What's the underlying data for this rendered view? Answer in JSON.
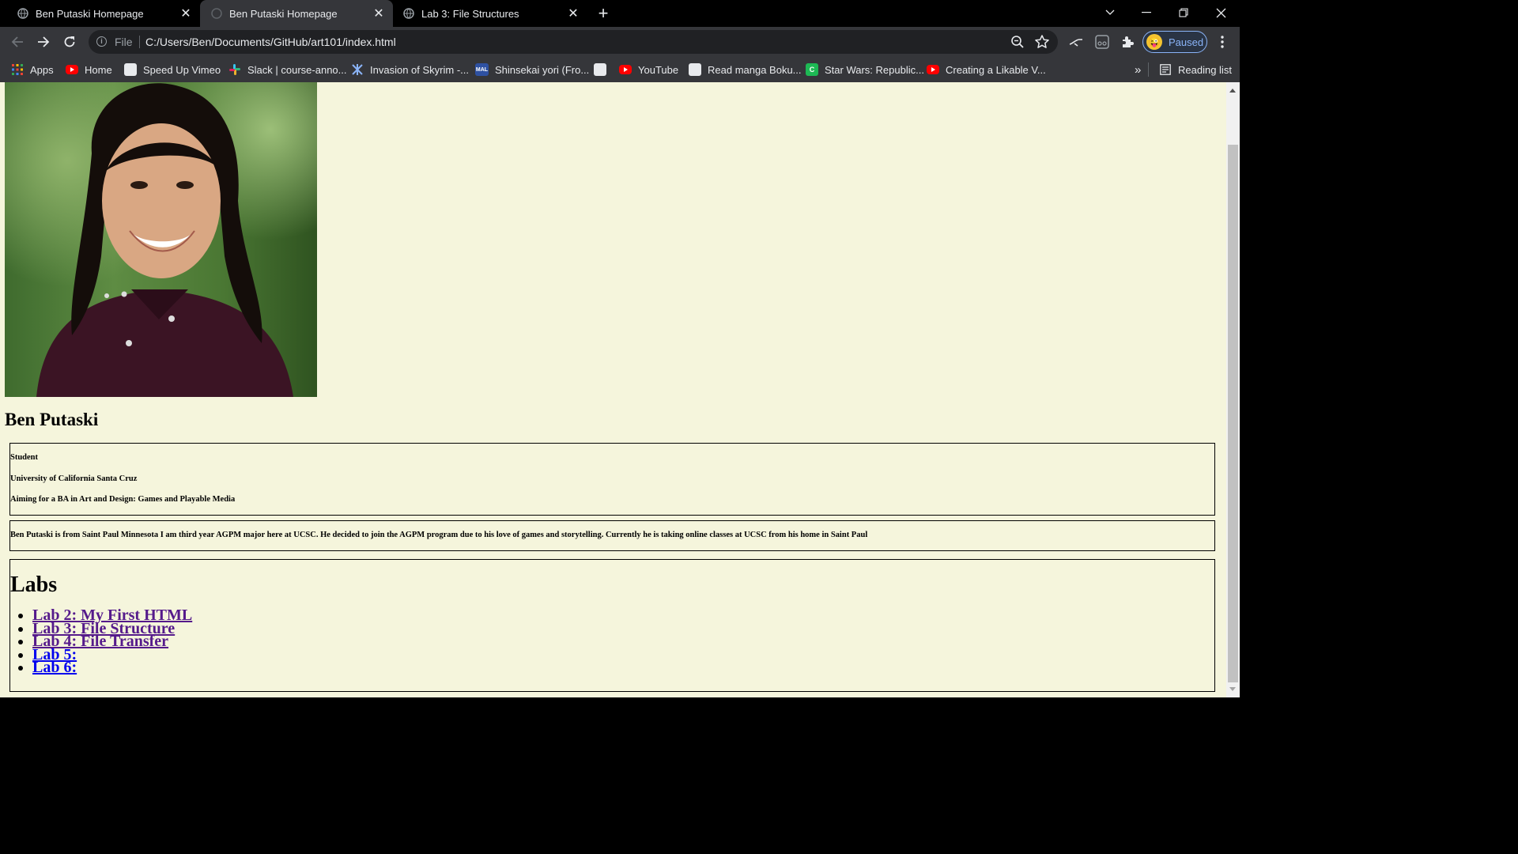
{
  "tabs": [
    {
      "title": "Ben Putaski Homepage",
      "active": false
    },
    {
      "title": "Ben Putaski Homepage",
      "active": true
    },
    {
      "title": "Lab 3: File Structures",
      "active": false
    }
  ],
  "toolbar": {
    "scheme": "File",
    "url": "C:/Users/Ben/Documents/GitHub/art101/index.html",
    "profile_label": "Paused"
  },
  "bookmarks": {
    "items": [
      {
        "label": "Apps",
        "icon": "apps-grid-icon"
      },
      {
        "label": "Home",
        "icon": "youtube-icon"
      },
      {
        "label": "Speed Up Vimeo",
        "icon": "globe-icon"
      },
      {
        "label": "Slack | course-anno...",
        "icon": "slack-icon"
      },
      {
        "label": "Invasion of Skyrim -...",
        "icon": "nexus-icon"
      },
      {
        "label": "Shinsekai yori (Fro...",
        "icon": "mal-icon"
      },
      {
        "label": "",
        "icon": "globe-icon"
      },
      {
        "label": "YouTube",
        "icon": "youtube-icon"
      },
      {
        "label": "Read manga Boku...",
        "icon": "globe-icon"
      },
      {
        "label": "Star Wars: Republic...",
        "icon": "cactus-icon"
      },
      {
        "label": "Creating a Likable V...",
        "icon": "youtube-icon"
      }
    ],
    "overflow": "»",
    "reading_list": "Reading list",
    "mal_badge": "MAL"
  },
  "page": {
    "name": "Ben Putaski",
    "info": [
      "Student",
      "University of California Santa Cruz",
      "Aiming for a BA in Art and Design: Games and Playable Media"
    ],
    "bio": "Ben Putaski is from Saint Paul Minnesota I am third year AGPM major here at UCSC. He decided to join the AGPM program due to his love of games and storytelling. Currently he is taking online classes at UCSC from his home in Saint Paul",
    "labs_heading": "Labs",
    "labs": [
      {
        "label": "Lab 2: My First HTML",
        "visited": true
      },
      {
        "label": "Lab 3: File Structure",
        "visited": true
      },
      {
        "label": "Lab 4: File Transfer",
        "visited": true
      },
      {
        "label": "Lab 5:",
        "visited": false
      },
      {
        "label": "Lab 6:",
        "visited": false
      }
    ]
  },
  "colors": {
    "page_background": "#f5f5dc",
    "link": "#0000ee",
    "visited_link": "#551a8b",
    "chrome_dark": "#35363a",
    "profile_accent": "#8ab4f8"
  }
}
